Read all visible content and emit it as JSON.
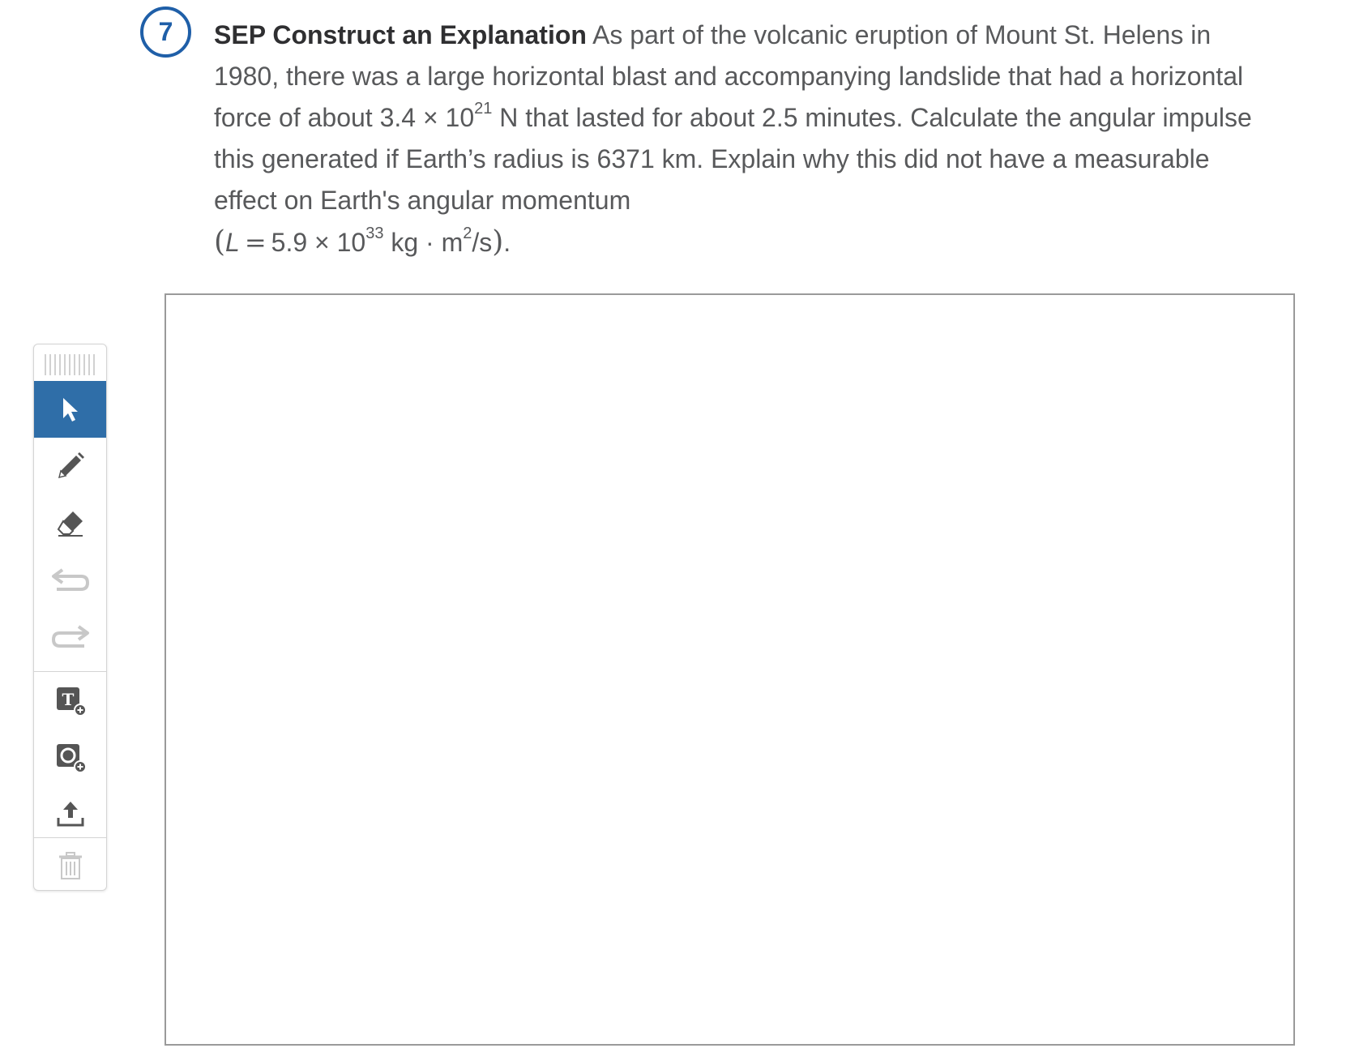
{
  "question": {
    "number": "7",
    "lead": "SEP Construct an Explanation",
    "text_1": " As part of the volcanic eruption of Mount St. Helens in 1980, there was a large horizontal blast and accompanying landslide that had a horizontal force of about 3.4 × 10",
    "force_exponent": "21",
    "text_2": " N that lasted for about 2.5 minutes. Calculate the angular impulse this generated if Earth’s radius is 6371 km. Explain why this did not have a measurable effect on Earth's angular momentum",
    "formula": {
      "open_paren": "(",
      "variable": "L",
      "equals": "=",
      "value": "5.9 × 10",
      "exponent": "33",
      "unit_1": " kg · m",
      "unit_exponent": "2",
      "unit_2": "/s",
      "close_paren": ")",
      "period": "."
    }
  },
  "toolbar": {
    "tools": [
      {
        "name": "select",
        "icon": "cursor-arrow-icon",
        "active": true
      },
      {
        "name": "pencil",
        "icon": "pencil-icon",
        "active": false
      },
      {
        "name": "eraser",
        "icon": "eraser-icon",
        "active": false
      },
      {
        "name": "undo",
        "icon": "undo-icon",
        "active": false,
        "disabled": true
      },
      {
        "name": "redo",
        "icon": "redo-icon",
        "active": false,
        "disabled": true
      },
      {
        "name": "add-text",
        "icon": "text-add-icon",
        "active": false
      },
      {
        "name": "add-shape",
        "icon": "shape-add-icon",
        "active": false
      },
      {
        "name": "upload",
        "icon": "upload-icon",
        "active": false
      },
      {
        "name": "delete",
        "icon": "trash-icon",
        "active": false,
        "disabled": true
      }
    ],
    "text_tool_glyph": "T"
  },
  "colors": {
    "accent": "#1f5fa8",
    "active_tool_bg": "#2f6ea8",
    "body_text": "#58595b",
    "icon": "#555555",
    "icon_disabled": "#c8c8c8"
  }
}
